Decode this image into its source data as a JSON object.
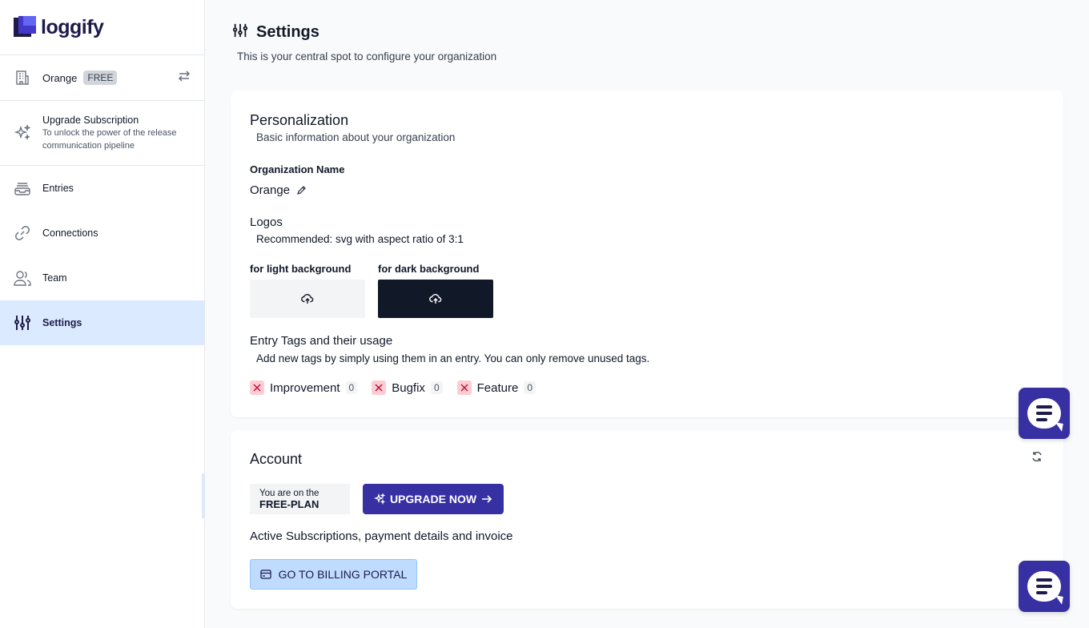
{
  "brand": {
    "name": "loggify",
    "accent": "#3730a3",
    "logo_colors": [
      "#1e1b4b",
      "#4338ca",
      "#6366f1"
    ]
  },
  "org": {
    "name": "Orange",
    "plan_badge": "FREE",
    "icon": "building-icon",
    "switch_icon": "swap-arrows-icon"
  },
  "upgrade": {
    "title": "Upgrade Subscription",
    "subtitle": "To unlock the power of the release communication pipeline",
    "icon": "sparkles-icon"
  },
  "nav": [
    {
      "label": "Entries",
      "icon": "stack-icon",
      "active": false
    },
    {
      "label": "Connections",
      "icon": "link-icon",
      "active": false
    },
    {
      "label": "Team",
      "icon": "users-icon",
      "active": false
    },
    {
      "label": "Settings",
      "icon": "sliders-icon",
      "active": true
    }
  ],
  "page": {
    "title": "Settings",
    "subtitle": "This is your central spot to configure your organization"
  },
  "personalization": {
    "title": "Personalization",
    "subtitle": "Basic information about your organization",
    "org_name_label": "Organization Name",
    "org_name_value": "Orange",
    "logos_title": "Logos",
    "logos_hint": "Recommended: svg with aspect ratio of 3:1",
    "light_label": "for light background",
    "dark_label": "for dark background",
    "tags_title": "Entry Tags and their usage",
    "tags_hint": "Add new tags by simply using them in an entry. You can only remove unused tags.",
    "tags": [
      {
        "label": "Improvement",
        "count": "0"
      },
      {
        "label": "Bugfix",
        "count": "0"
      },
      {
        "label": "Feature",
        "count": "0"
      }
    ]
  },
  "account": {
    "title": "Account",
    "plan_prefix": "You are on the",
    "plan_name": "FREE-PLAN",
    "upgrade_button": "UPGRADE NOW",
    "billing_text": "Active Subscriptions, payment details and invoice",
    "billing_button": "GO TO BILLING PORTAL"
  }
}
